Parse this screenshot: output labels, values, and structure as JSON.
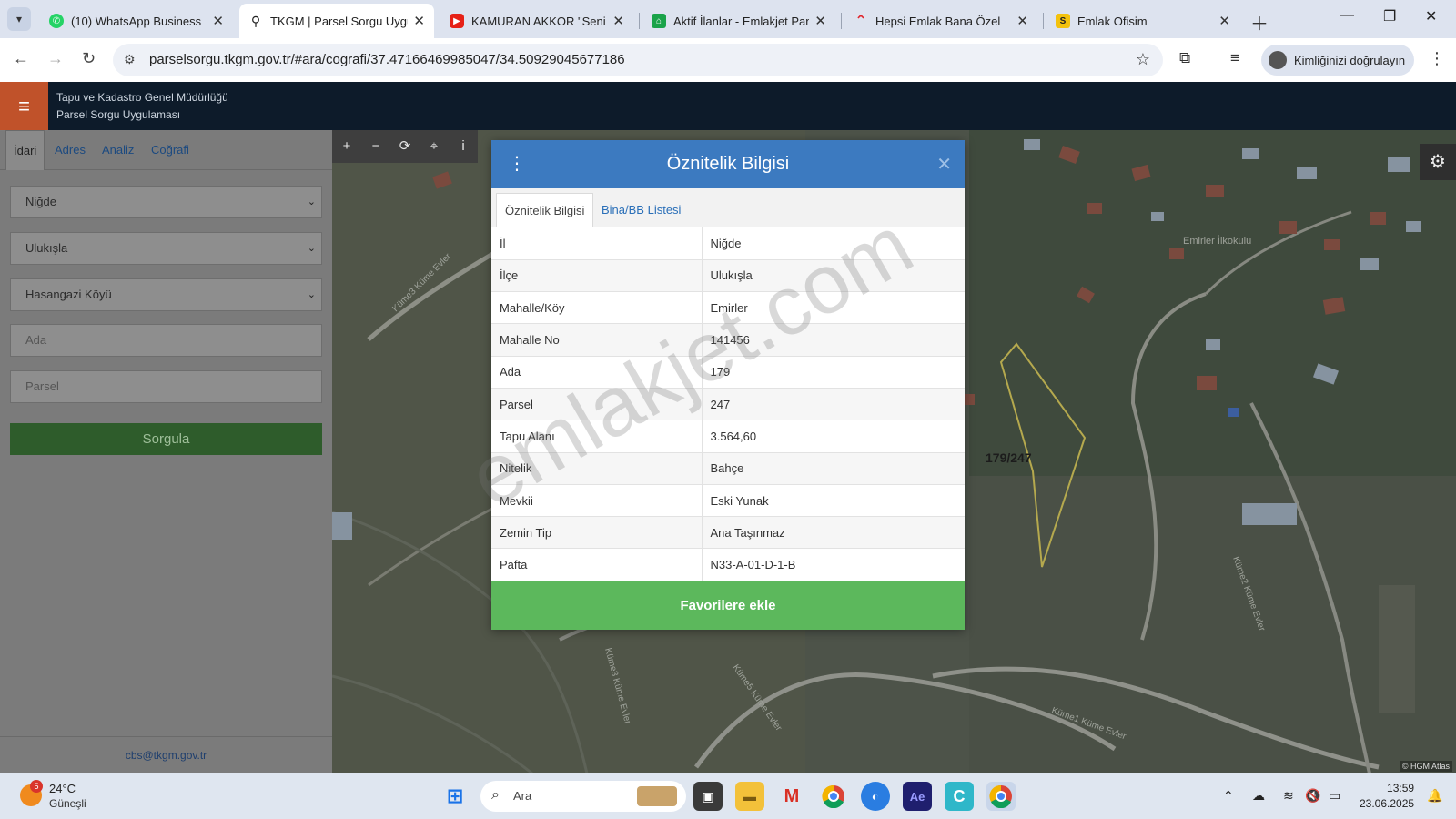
{
  "browser": {
    "tabs": [
      {
        "title": "(10) WhatsApp Business",
        "icon": "whatsapp-icon",
        "color": "#25d366"
      },
      {
        "title": "TKGM | Parsel Sorgu Uygulaması",
        "icon": "location-pin-icon",
        "color": "#222222"
      },
      {
        "title": "KAMURAN AKKOR \"Seni kim",
        "icon": "youtube-icon",
        "color": "#e62117"
      },
      {
        "title": "Aktif İlanlar - Emlakjet Panel",
        "icon": "emlakjet-icon",
        "color": "#1aa34a"
      },
      {
        "title": "Hepsi Emlak Bana Özel",
        "icon": "hepsiemlak-icon",
        "color": "#e0262d"
      },
      {
        "title": "Emlak Ofisim",
        "icon": "emlak-ofisim-icon",
        "color": "#f4c20d",
        "glyph": "S"
      }
    ],
    "url": "parselsorgu.tkgm.gov.tr/#ara/cografi/37.47166469985047/34.50929045677186",
    "profile_label": "Kimliğinizi doğrulayın"
  },
  "app": {
    "title_line1": "Tapu ve Kadastro Genel Müdürlüğü",
    "title_line2": "Parsel Sorgu Uygulaması"
  },
  "sidebar": {
    "tabs": [
      "İdari",
      "Adres",
      "Analiz",
      "Coğrafi"
    ],
    "il": "Niğde",
    "ilce": "Ulukışla",
    "mahalle": "Hasangazi Köyü",
    "ada_placeholder": "Ada",
    "parsel_placeholder": "Parsel",
    "submit_label": "Sorgula",
    "footer_email": "cbs@tkgm.gov.tr"
  },
  "map": {
    "parcel_label": "179/247",
    "school_label": "Emirler İlkokulu",
    "road_labels": [
      "Küme3 Küme Evler",
      "Küme3 Küme Evler",
      "Küme5 Küme Evler",
      "Küme2 Küme Evler",
      "Küme1 Küme Evler"
    ],
    "attribution": "© HGM Atlas",
    "watermark": "emlakjet.com"
  },
  "dialog": {
    "title": "Öznitelik Bilgisi",
    "tab_active": "Öznitelik Bilgisi",
    "tab_other": "Bina/BB Listesi",
    "rows": [
      {
        "key": "İl",
        "value": "Niğde"
      },
      {
        "key": "İlçe",
        "value": "Ulukışla"
      },
      {
        "key": "Mahalle/Köy",
        "value": "Emirler"
      },
      {
        "key": "Mahalle No",
        "value": "141456"
      },
      {
        "key": "Ada",
        "value": "179"
      },
      {
        "key": "Parsel",
        "value": "247"
      },
      {
        "key": "Tapu Alanı",
        "value": "3.564,60"
      },
      {
        "key": "Nitelik",
        "value": "Bahçe"
      },
      {
        "key": "Mevkii",
        "value": "Eski Yunak"
      },
      {
        "key": "Zemin Tip",
        "value": "Ana Taşınmaz"
      },
      {
        "key": "Pafta",
        "value": "N33-A-01-D-1-B"
      }
    ],
    "button_label": "Favorilere ekle"
  },
  "taskbar": {
    "temperature": "24°C",
    "condition": "Güneşli",
    "weather_badge": "5",
    "search_placeholder": "Ara",
    "time": "13:59",
    "date": "23.06.2025"
  }
}
